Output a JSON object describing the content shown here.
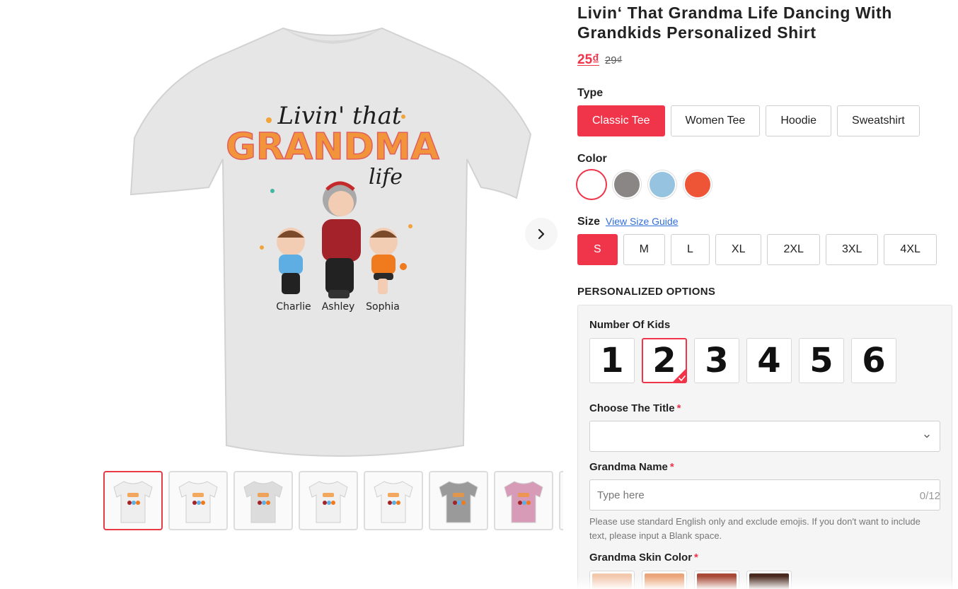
{
  "product": {
    "title": "Livin‘ That Grandma Life Dancing With Grandkids Personalized Shirt",
    "price_now": "25₫",
    "price_old": "29₫"
  },
  "gallery": {
    "artwork_text": {
      "line1": "Livin' that",
      "line2": "GRANDMA",
      "line3": "life",
      "names": [
        "Charlie",
        "Ashley",
        "Sophia"
      ]
    },
    "next_icon": "chevron-right-icon",
    "thumbnails": [
      {
        "color": "#eeeeee",
        "active": true
      },
      {
        "color": "#f2f2f2",
        "active": false
      },
      {
        "color": "#dcdcdc",
        "active": false
      },
      {
        "color": "#f0f0f0",
        "active": false
      },
      {
        "color": "#f4f4f4",
        "active": false
      },
      {
        "color": "#9a9a9a",
        "active": false
      },
      {
        "color": "#d79ab7",
        "active": false
      }
    ]
  },
  "type": {
    "label": "Type",
    "options": [
      "Classic Tee",
      "Women Tee",
      "Hoodie",
      "Sweatshirt"
    ],
    "selected": "Classic Tee"
  },
  "color": {
    "label": "Color",
    "swatches": [
      "#ffffff",
      "#8b8686",
      "#95c3e0",
      "#ee5536"
    ],
    "selected": "#ffffff"
  },
  "size": {
    "label": "Size",
    "guide_link": "View Size Guide",
    "options": [
      "S",
      "M",
      "L",
      "XL",
      "2XL",
      "3XL",
      "4XL"
    ],
    "selected": "S"
  },
  "personalized": {
    "heading": "PERSONALIZED OPTIONS",
    "kids": {
      "label": "Number Of Kids",
      "options": [
        "1",
        "2",
        "3",
        "4",
        "5",
        "6"
      ],
      "selected": "2"
    },
    "title_select": {
      "label": "Choose The Title",
      "required_mark": "*",
      "value": ""
    },
    "grandma_name": {
      "label": "Grandma Name",
      "required_mark": "*",
      "placeholder": "Type here",
      "counter": "0/12",
      "hint": "Please use standard English only and exclude emojis. If you don't want to include text, please input a Blank space."
    },
    "skin_color": {
      "label": "Grandma Skin Color",
      "required_mark": "*",
      "swatches": [
        "#f3c9ae",
        "#eba57a",
        "#a84a36",
        "#4a2a1f"
      ]
    }
  }
}
